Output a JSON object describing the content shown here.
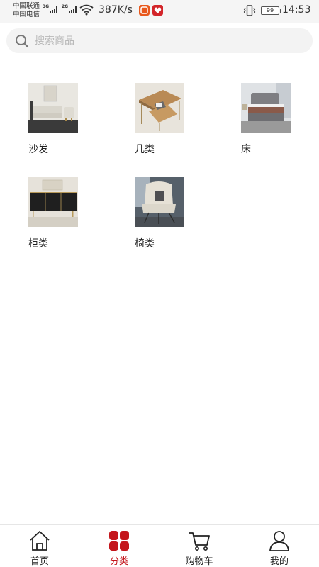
{
  "status_bar": {
    "carrier_1": "中国联通",
    "carrier_2": "中国电信",
    "net_1": "3G",
    "net_2": "2G",
    "speed": "387K/s",
    "battery": "99",
    "time": "14:53"
  },
  "search": {
    "placeholder": "搜索商品",
    "value": ""
  },
  "categories": [
    {
      "label": "沙发",
      "icon": "sofa-thumbnail"
    },
    {
      "label": "几类",
      "icon": "coffee-table-thumbnail"
    },
    {
      "label": "床",
      "icon": "bed-thumbnail"
    },
    {
      "label": "柜类",
      "icon": "cabinet-thumbnail"
    },
    {
      "label": "椅类",
      "icon": "chair-thumbnail"
    }
  ],
  "tabbar": {
    "active_index": 1,
    "accent_color": "#c4161c",
    "tabs": [
      {
        "label": "首页",
        "icon": "home-icon"
      },
      {
        "label": "分类",
        "icon": "category-grid-icon"
      },
      {
        "label": "购物车",
        "icon": "cart-icon"
      },
      {
        "label": "我的",
        "icon": "user-icon"
      }
    ]
  }
}
